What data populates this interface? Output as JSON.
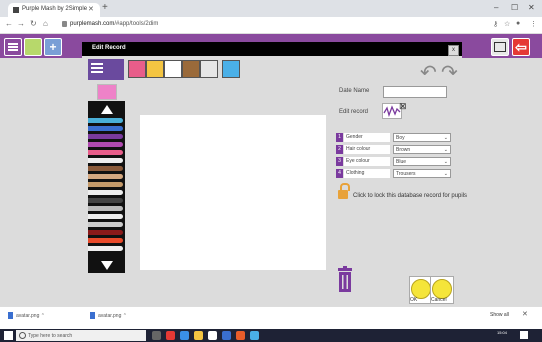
{
  "browser": {
    "tab_title": "Purple Mash by 2Simple",
    "url_domain": "purplemash.com",
    "url_path": "/#app/tools/2dim",
    "colors": {
      "chrome": "#dee1e6"
    }
  },
  "app": {
    "colors": {
      "accent": "#8a4a9e",
      "back_button": "#e53935"
    },
    "toolbar_icons": [
      "menu-icon",
      "chart-icon",
      "plus-icon",
      "slideshow-icon",
      "back-arrow-icon"
    ]
  },
  "dialog": {
    "title": "Edit Record",
    "close_label": "x",
    "tools": [
      "pen-tool-icon",
      "shapes-icon",
      "people-icon",
      "text-icon",
      "frame-icon",
      "camera-icon",
      "grid-icon"
    ],
    "date_label": "Date Name",
    "edit_label": "Edit record",
    "fields": [
      {
        "num": "1",
        "label": "Gender",
        "value": "Boy"
      },
      {
        "num": "2",
        "label": "Hair colour",
        "value": "Brown"
      },
      {
        "num": "3",
        "label": "Eye colour",
        "value": "Blue"
      },
      {
        "num": "4",
        "label": "Clothing",
        "value": "Trousers"
      }
    ],
    "lock_text": "Click to lock this database record for pupils",
    "ok_label": "OK",
    "cancel_label": "Cancel",
    "pens": [
      "#4ab0d8",
      "#3a6fd0",
      "#7a3a9e",
      "#b04ab0",
      "#e85d8a",
      "#eeeeee",
      "#8a5a3a",
      "#d4a880",
      "#c49a6a",
      "#eeeeee",
      "#444444",
      "#bbbbbb",
      "#eeeeee",
      "#cccccc",
      "#8a1a1a",
      "#e84a2a",
      "#eeeeee"
    ]
  },
  "downloads": {
    "items": [
      "avatar.png",
      "avatar.png"
    ],
    "show_all": "Show all"
  },
  "taskbar": {
    "search_placeholder": "Type here to search",
    "clock": "15:04"
  }
}
